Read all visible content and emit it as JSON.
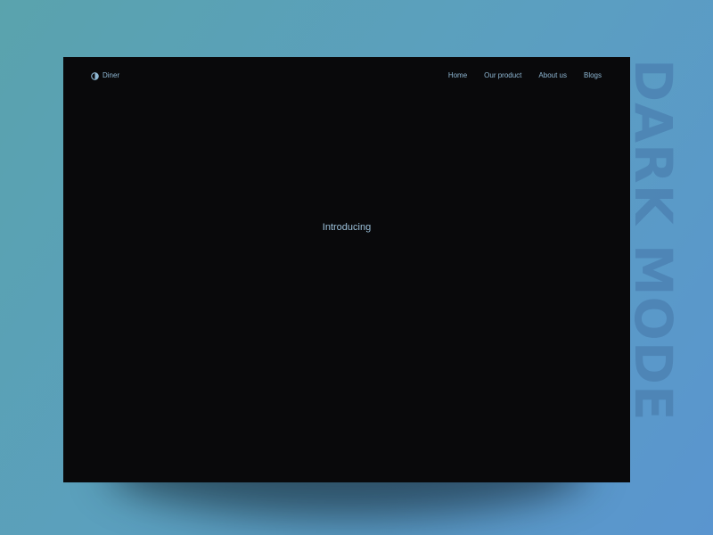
{
  "brand": {
    "name": "Diner",
    "icon": "half-circle-contrast-icon"
  },
  "nav": {
    "items": [
      {
        "label": "Home"
      },
      {
        "label": "Our product"
      },
      {
        "label": "About us"
      },
      {
        "label": "Blogs"
      }
    ]
  },
  "hero": {
    "text": "Introducing"
  },
  "watermark": {
    "text": "DARK MODE"
  },
  "colors": {
    "background_start": "#5aa3ad",
    "background_end": "#5a95cf",
    "screen": "#09090b",
    "text_accent": "#8fb8d4",
    "watermark": "#4a7fb0"
  }
}
